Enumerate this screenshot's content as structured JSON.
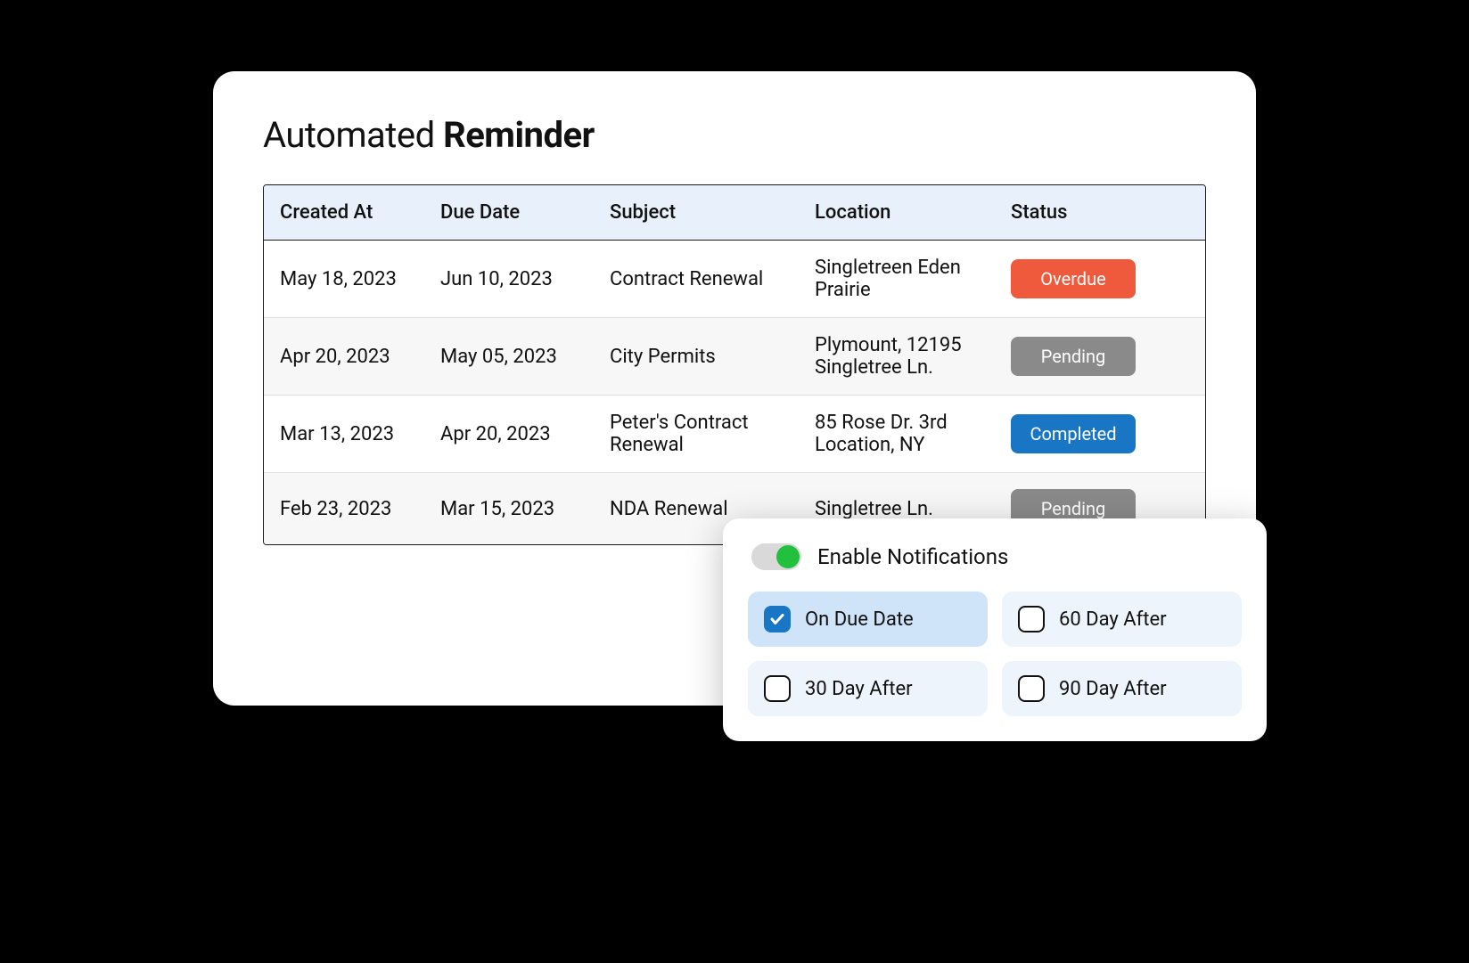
{
  "title": {
    "prefix": "Automated ",
    "bold": "Reminder"
  },
  "table": {
    "headers": {
      "created": "Created At",
      "due": "Due Date",
      "subject": "Subject",
      "location": "Location",
      "status": "Status"
    },
    "rows": [
      {
        "created": "May 18, 2023",
        "due": "Jun 10, 2023",
        "subject": "Contract Renewal",
        "location": "Singletreen Eden Prairie",
        "status": "Overdue",
        "statusClass": "overdue"
      },
      {
        "created": "Apr 20, 2023",
        "due": "May 05, 2023",
        "subject": "City Permits",
        "location": "Plymount, 12195 Singletree Ln.",
        "status": "Pending",
        "statusClass": "pending"
      },
      {
        "created": "Mar 13, 2023",
        "due": "Apr 20, 2023",
        "subject": "Peter's Contract Renewal",
        "location": "85 Rose Dr. 3rd Location, NY",
        "status": "Completed",
        "statusClass": "completed"
      },
      {
        "created": "Feb 23, 2023",
        "due": "Mar 15, 2023",
        "subject": "NDA Renewal",
        "location": "Singletree Ln.",
        "status": "Pending",
        "statusClass": "pending"
      }
    ]
  },
  "popup": {
    "toggleLabel": "Enable Notifications",
    "toggleOn": true,
    "options": [
      {
        "label": "On Due Date",
        "checked": true
      },
      {
        "label": "60 Day After",
        "checked": false
      },
      {
        "label": "30 Day After",
        "checked": false
      },
      {
        "label": "90 Day After",
        "checked": false
      }
    ]
  }
}
